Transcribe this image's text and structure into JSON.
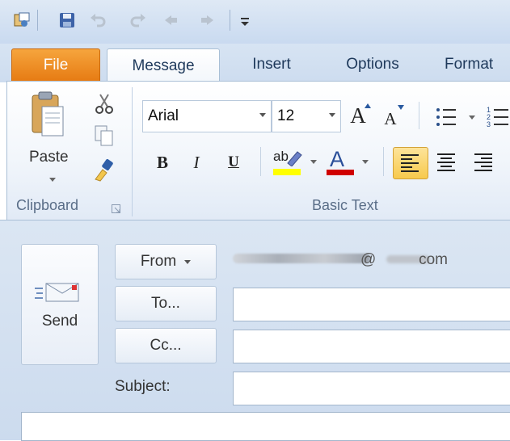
{
  "quick_access": {
    "icons": [
      "app-icon",
      "save-icon",
      "undo-icon",
      "redo-icon",
      "previous-icon",
      "next-icon",
      "customize-icon"
    ]
  },
  "tabs": [
    {
      "label": "File",
      "active": false
    },
    {
      "label": "Message",
      "active": true
    },
    {
      "label": "Insert",
      "active": false
    },
    {
      "label": "Options",
      "active": false
    },
    {
      "label": "Format",
      "active": false
    }
  ],
  "ribbon": {
    "clipboard": {
      "paste_label": "Paste",
      "group_label": "Clipboard"
    },
    "basic_text": {
      "font_name": "Arial",
      "font_size": "12",
      "group_label": "Basic Text",
      "bold": "B",
      "italic": "I",
      "underline": "U",
      "font_color_glyph": "A",
      "highlight_glyph": "ab",
      "grow_font_glyph": "A",
      "shrink_font_glyph": "A"
    }
  },
  "compose": {
    "send_label": "Send",
    "from_label": "From",
    "from_value": "@          com",
    "to_label": "To...",
    "cc_label": "Cc...",
    "subject_label": "Subject:",
    "to_value": "",
    "cc_value": "",
    "subject_value": ""
  },
  "colors": {
    "file_tab": "#e67a12",
    "highlight": "#ffff00",
    "font_color": "#d00000",
    "align_active": "#fbd86a"
  }
}
